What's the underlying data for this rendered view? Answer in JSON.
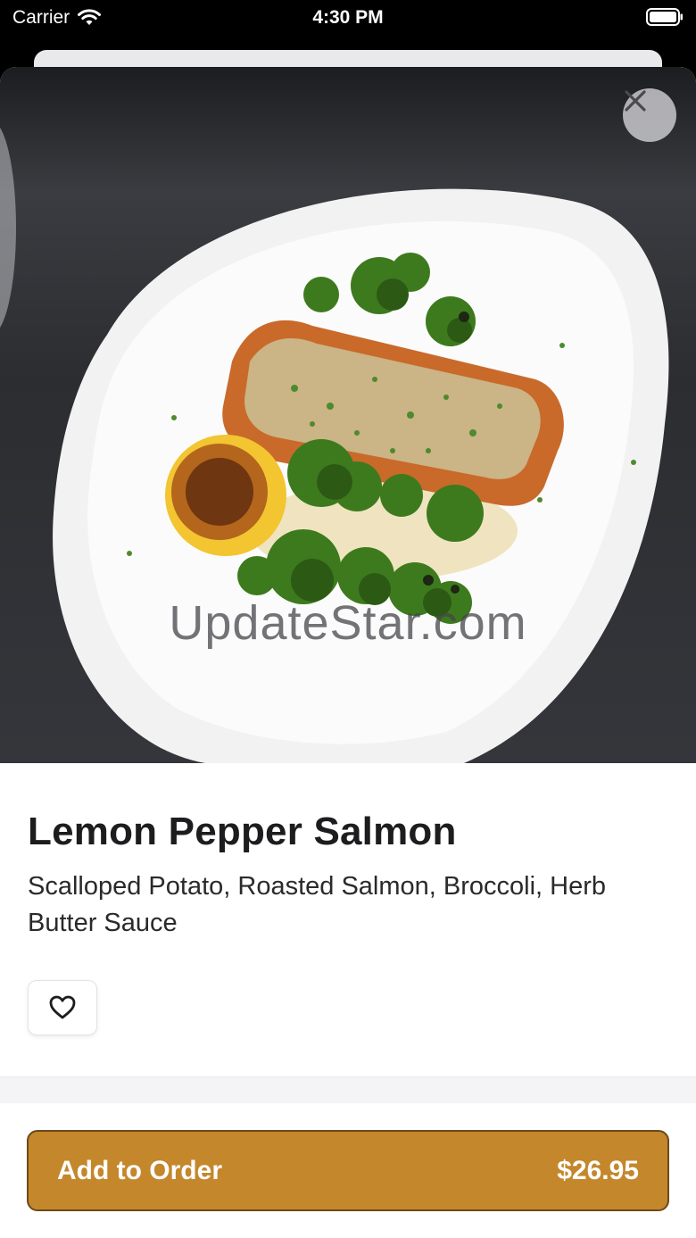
{
  "status_bar": {
    "carrier": "Carrier",
    "time": "4:30 PM"
  },
  "item": {
    "watermark": "UpdateStar.com",
    "name": "Lemon Pepper Salmon",
    "description": "Scalloped Potato, Roasted Salmon, Broccoli, Herb Butter Sauce",
    "price": "$26.95"
  },
  "actions": {
    "add_to_order_label": "Add to Order",
    "close_icon": "close-icon",
    "favorite_icon": "heart-outline-icon"
  },
  "colors": {
    "accent": "#c4872c",
    "accent_border": "#6b4a18",
    "text_primary": "#1d1d1f"
  }
}
